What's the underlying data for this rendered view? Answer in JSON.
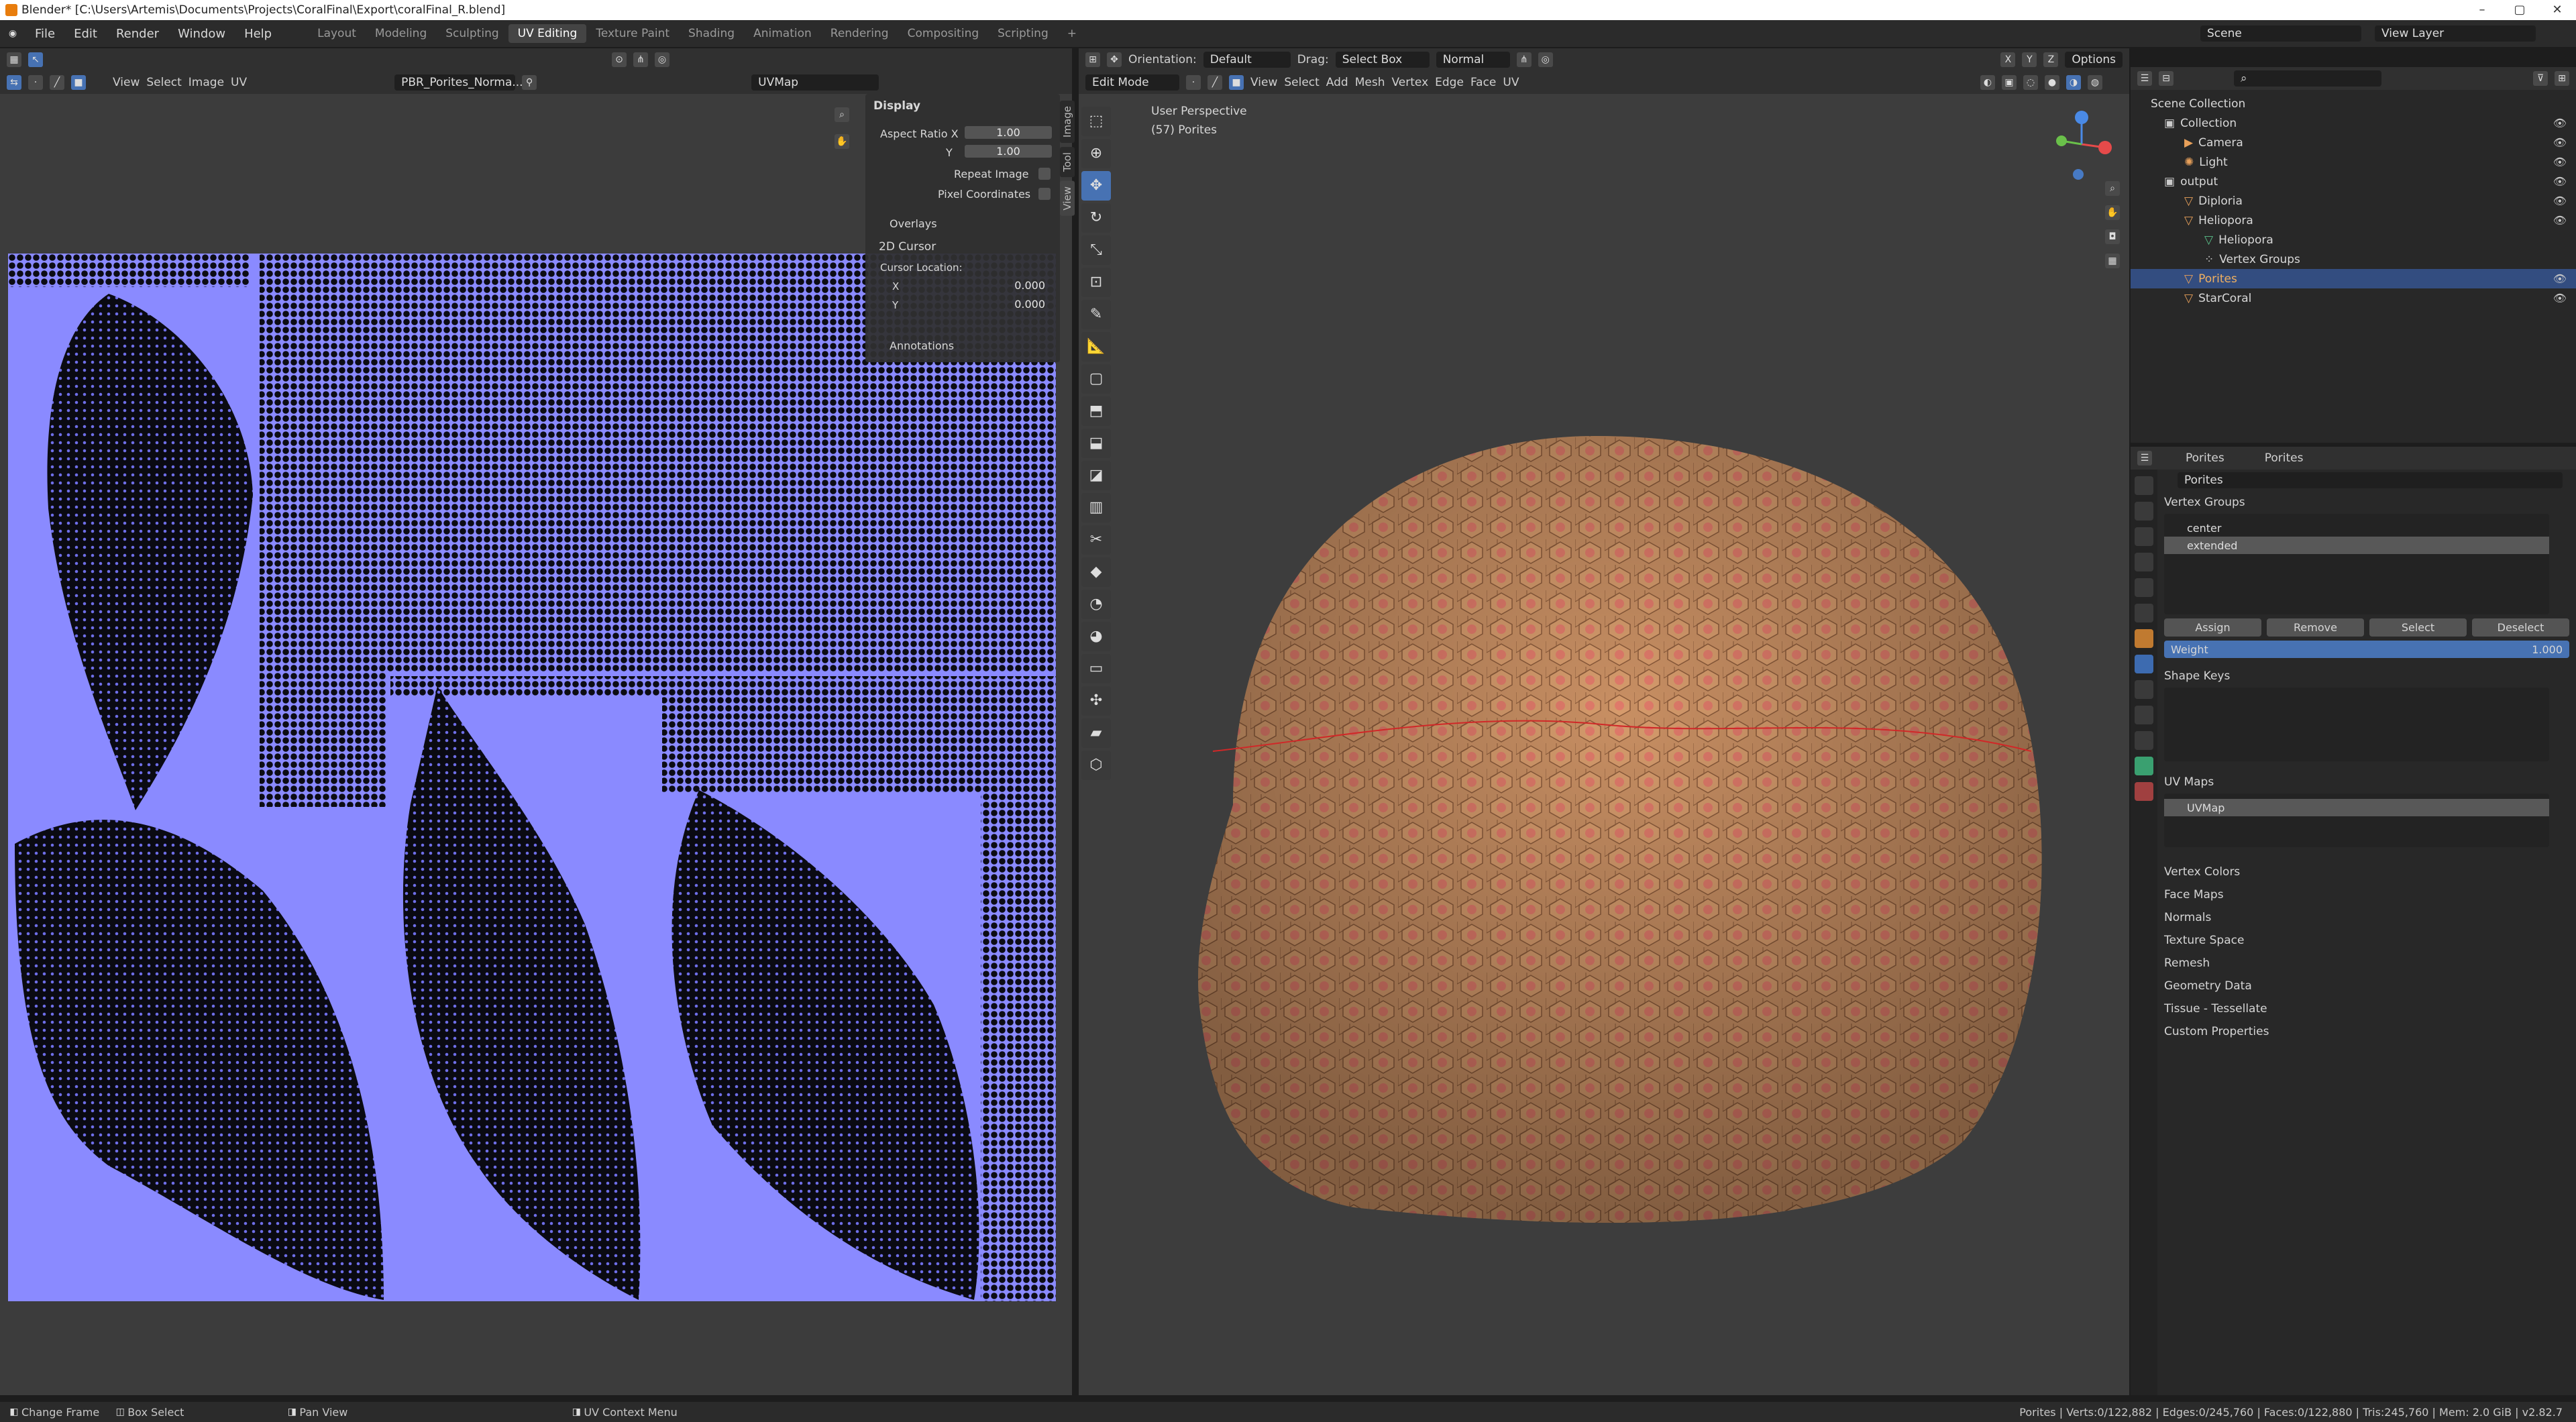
{
  "window": {
    "title": "Blender* [C:\\Users\\Artemis\\Documents\\Projects\\CoralFinal\\Export\\coralFinal_R.blend]",
    "controls": [
      "–",
      "▢",
      "✕"
    ]
  },
  "menu": [
    "File",
    "Edit",
    "Render",
    "Window",
    "Help"
  ],
  "workspaces": [
    "Layout",
    "Modeling",
    "Sculpting",
    "UV Editing",
    "Texture Paint",
    "Shading",
    "Animation",
    "Rendering",
    "Compositing",
    "Scripting"
  ],
  "active_workspace": "UV Editing",
  "scene": {
    "label": "Scene",
    "view_layer": "View Layer"
  },
  "uv_editor": {
    "menus": [
      "View",
      "Select",
      "Image",
      "UV"
    ],
    "image_name": "PBR_Porites_Norma...",
    "uvmap": "UVMap",
    "side_tabs": [
      "Image",
      "Tool",
      "View"
    ],
    "display": {
      "header": "Display",
      "aspect_label": "Aspect Ratio X",
      "aspect_x": "1.00",
      "y_label": "Y",
      "aspect_y": "1.00",
      "repeat": "Repeat Image",
      "pixel": "Pixel Coordinates"
    },
    "overlays": "Overlays",
    "cursor": {
      "header": "2D Cursor",
      "loc_label": "Cursor Location:",
      "x_label": "X",
      "x": "0.000",
      "y_label": "Y",
      "y": "0.000"
    },
    "annotations": "Annotations"
  },
  "viewport": {
    "orientation_label": "Orientation:",
    "orientation": "Default",
    "drag_label": "Drag:",
    "drag": "Select Box",
    "normal": "Normal",
    "options": "Options",
    "mode": "Edit Mode",
    "menus": [
      "View",
      "Select",
      "Add",
      "Mesh",
      "Vertex",
      "Edge",
      "Face",
      "UV"
    ],
    "info1": "User Perspective",
    "info2": "(57) Porites",
    "gizmo": [
      "X",
      "Y",
      "Z"
    ]
  },
  "outliner": {
    "rows": [
      {
        "label": "Scene Collection",
        "depth": 0
      },
      {
        "label": "Collection",
        "depth": 1
      },
      {
        "label": "Camera",
        "depth": 2
      },
      {
        "label": "Light",
        "depth": 2
      },
      {
        "label": "output",
        "depth": 1
      },
      {
        "label": "Diploria",
        "depth": 2
      },
      {
        "label": "Heliopora",
        "depth": 2
      },
      {
        "label": "Heliopora",
        "depth": 3
      },
      {
        "label": "Vertex Groups",
        "depth": 3
      },
      {
        "label": "Porites",
        "depth": 2
      },
      {
        "label": "StarCoral",
        "depth": 2
      }
    ]
  },
  "properties": {
    "crumb1": "Porites",
    "crumb2": "Porites",
    "name": "Porites",
    "vertex_groups": {
      "header": "Vertex Groups",
      "items": [
        "center",
        "extended"
      ],
      "buttons": [
        "Assign",
        "Remove",
        "Select",
        "Deselect"
      ],
      "weight_label": "Weight",
      "weight": "1.000"
    },
    "shape_keys": "Shape Keys",
    "uv_maps": {
      "header": "UV Maps",
      "items": [
        "UVMap"
      ]
    },
    "collapsed": [
      "Vertex Colors",
      "Face Maps",
      "Normals",
      "Texture Space",
      "Remesh",
      "Geometry Data",
      "Tissue - Tessellate",
      "Custom Properties"
    ]
  },
  "status": {
    "left": [
      "Change Frame",
      "Box Select",
      "Pan View",
      "UV Context Menu"
    ],
    "right": "Porites | Verts:0/122,882 | Edges:0/245,760 | Faces:0/122,880 | Tris:245,760 | Mem: 2.0 GiB | v2.82.7"
  },
  "colors": {
    "uv_bg": "#8a8aff",
    "mesh": "#c08a60",
    "selection": "#4772b3"
  }
}
